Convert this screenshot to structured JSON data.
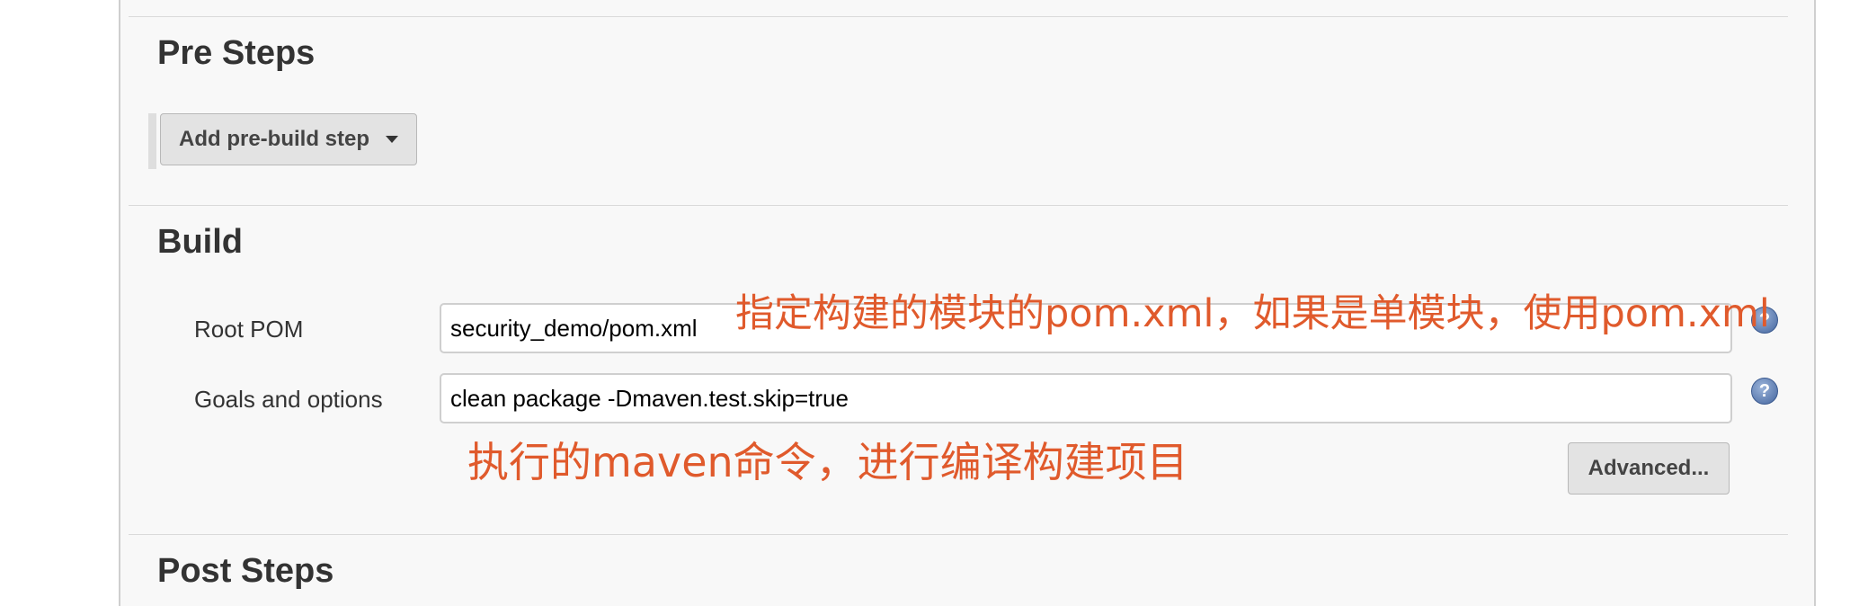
{
  "pre_steps": {
    "title": "Pre Steps",
    "add_button_label": "Add pre-build step"
  },
  "build": {
    "title": "Build",
    "root_pom": {
      "label": "Root POM",
      "value": "security_demo/pom.xml",
      "help": "?"
    },
    "goals": {
      "label": "Goals and options",
      "value": "clean package -Dmaven.test.skip=true",
      "help": "?"
    },
    "advanced_label": "Advanced..."
  },
  "post_steps": {
    "title": "Post Steps"
  },
  "annotations": {
    "root_pom_note": "指定构建的模块的pom.xml，如果是单模块，使用pom.xml",
    "goals_note": "执行的maven命令，进行编译构建项目",
    "color": "#e05a2c"
  }
}
